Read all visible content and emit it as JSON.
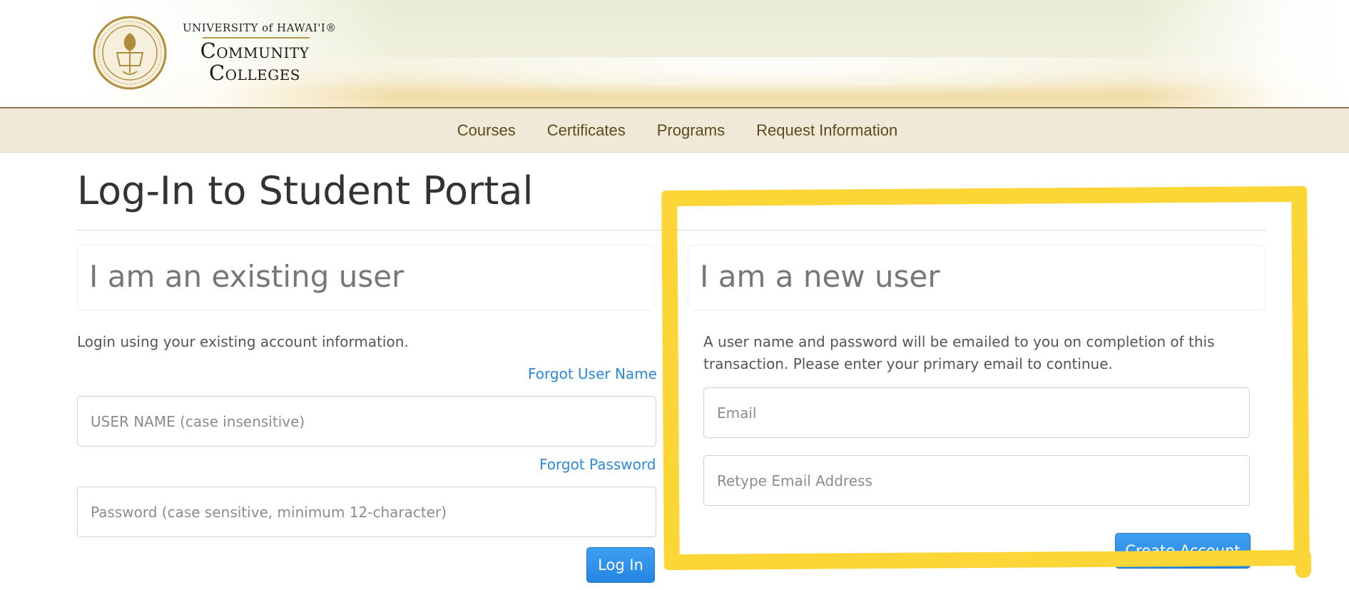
{
  "header": {
    "brand_top": "UNIVERSITY of HAWAI'I®",
    "brand_main": "Community Colleges",
    "colors": {
      "nav_background": "#f1e9d7",
      "nav_text": "#5d4a1e",
      "rule": "#8b7a52",
      "seal": "#b08d3c"
    }
  },
  "nav": {
    "items": [
      "Courses",
      "Certificates",
      "Programs",
      "Request Information"
    ]
  },
  "page": {
    "title": "Log-In to Student Portal"
  },
  "existing": {
    "heading": "I am an existing user",
    "intro": "Login using your existing account information.",
    "forgot_user": "Forgot User Name",
    "username_placeholder": "USER NAME (case insensitive)",
    "forgot_password": "Forgot Password",
    "password_placeholder": "Password (case sensitive, minimum 12-character)",
    "login_label": "Log In"
  },
  "new_user": {
    "heading": "I am a new user",
    "intro": "A user name and password will be emailed to you on completion of this transaction. Please enter your primary email to continue.",
    "email_placeholder": "Email",
    "retype_placeholder": "Retype Email Address",
    "create_label": "Create Account"
  },
  "colors": {
    "link": "#2b8ad9",
    "button": "#2585e0",
    "annotation": "#fcd636"
  }
}
